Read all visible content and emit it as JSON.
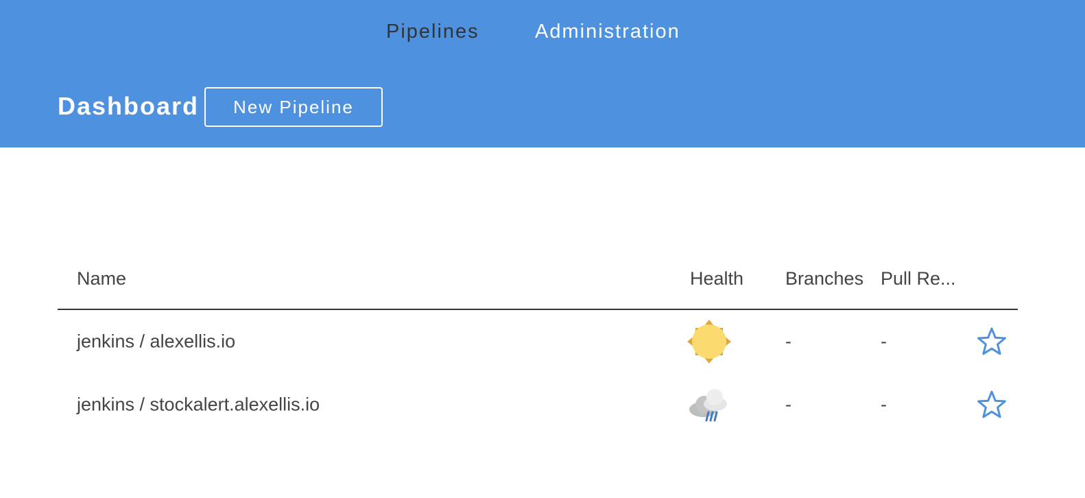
{
  "nav": {
    "pipelines": "Pipelines",
    "administration": "Administration"
  },
  "header": {
    "title": "Dashboard",
    "new_pipeline_label": "New Pipeline"
  },
  "table": {
    "columns": {
      "name": "Name",
      "health": "Health",
      "branches": "Branches",
      "pull_requests": "Pull Re..."
    },
    "rows": [
      {
        "name": "jenkins / alexellis.io",
        "health_icon": "sunny-weather-icon",
        "branches": "-",
        "pull_requests": "-",
        "favorite_icon": "star-outline-icon"
      },
      {
        "name": "jenkins / stockalert.alexellis.io",
        "health_icon": "rainy-weather-icon",
        "branches": "-",
        "pull_requests": "-",
        "favorite_icon": "star-outline-icon"
      }
    ]
  },
  "colors": {
    "header_bg": "#4d91df",
    "accent": "#4d91df",
    "text": "#444444"
  }
}
